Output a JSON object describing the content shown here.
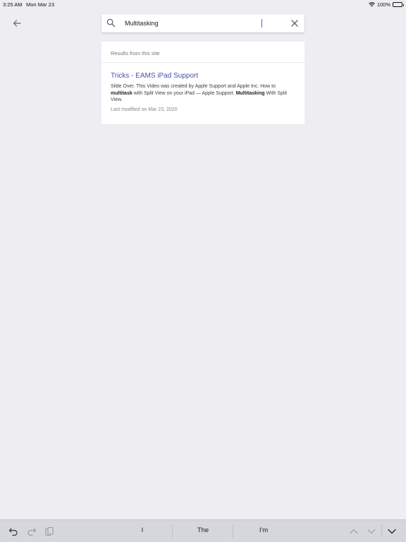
{
  "status_bar": {
    "time": "3:25 AM",
    "date": "Mon Mar 23",
    "battery": "100%"
  },
  "search": {
    "value": "Multitasking",
    "placeholder": ""
  },
  "results": {
    "header": "Results from this site",
    "items": [
      {
        "title": "Tricks - EAMS iPad Support",
        "snippet_1": "Silde Over. This Video was created by Apple Support and Apple Inc. How to ",
        "snippet_bold_1": "multitask",
        "snippet_2": " with Split View on your iPad — Apple Support. ",
        "snippet_bold_2": "Multitasking",
        "snippet_3": " With Split View.",
        "date": "Last modified on Mar 23, 2020"
      }
    ]
  },
  "keyboard": {
    "suggestions": [
      "I",
      "The",
      "I'm"
    ]
  },
  "icons": [
    "wifi-icon",
    "battery-icon",
    "back-arrow-icon",
    "search-icon",
    "close-icon",
    "undo-icon",
    "redo-icon",
    "paste-icon",
    "chevron-up-icon",
    "chevron-down-icon",
    "keyboard-dismiss-icon"
  ],
  "colors": {
    "background": "#eeedf1",
    "link": "#4a4fa8",
    "caret": "#3b6bd6",
    "keyboard_bar": "#d5d7dd"
  }
}
